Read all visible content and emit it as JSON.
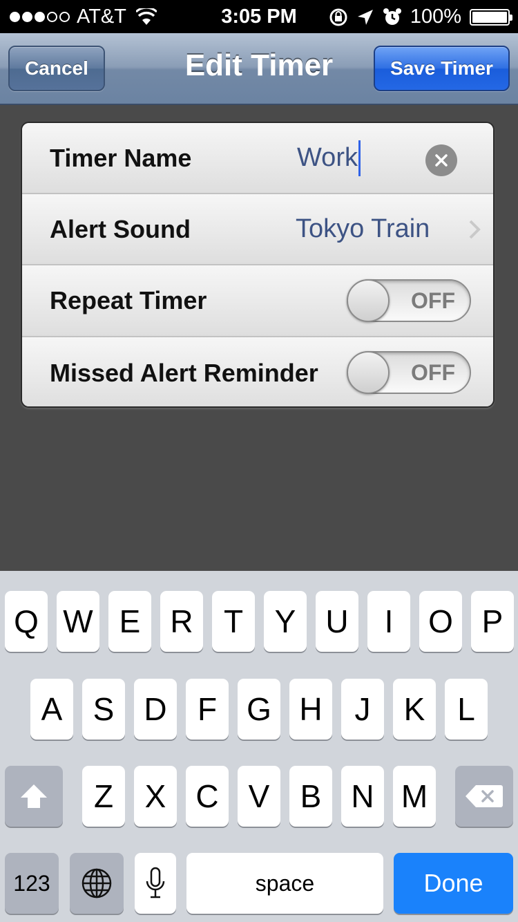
{
  "status_bar": {
    "carrier": "AT&T",
    "time": "3:05 PM",
    "battery": "100%",
    "signal_filled": 3,
    "signal_total": 5
  },
  "nav": {
    "title": "Edit Timer",
    "cancel_label": "Cancel",
    "save_label": "Save Timer"
  },
  "settings": {
    "timer_name_label": "Timer Name",
    "timer_name_value": "Work",
    "alert_sound_label": "Alert Sound",
    "alert_sound_value": "Tokyo Train",
    "repeat_label": "Repeat Timer",
    "repeat_state": "OFF",
    "missed_label": "Missed Alert Reminder",
    "missed_state": "OFF"
  },
  "keyboard": {
    "row1": [
      "Q",
      "W",
      "E",
      "R",
      "T",
      "Y",
      "U",
      "I",
      "O",
      "P"
    ],
    "row2": [
      "A",
      "S",
      "D",
      "F",
      "G",
      "H",
      "J",
      "K",
      "L"
    ],
    "row3": [
      "Z",
      "X",
      "C",
      "V",
      "B",
      "N",
      "M"
    ],
    "numbers_label": "123",
    "space_label": "space",
    "done_label": "Done"
  },
  "colors": {
    "accent_blue": "#1a82fb",
    "value_text": "#3d5384",
    "nav_bar": "#8a9db6"
  }
}
